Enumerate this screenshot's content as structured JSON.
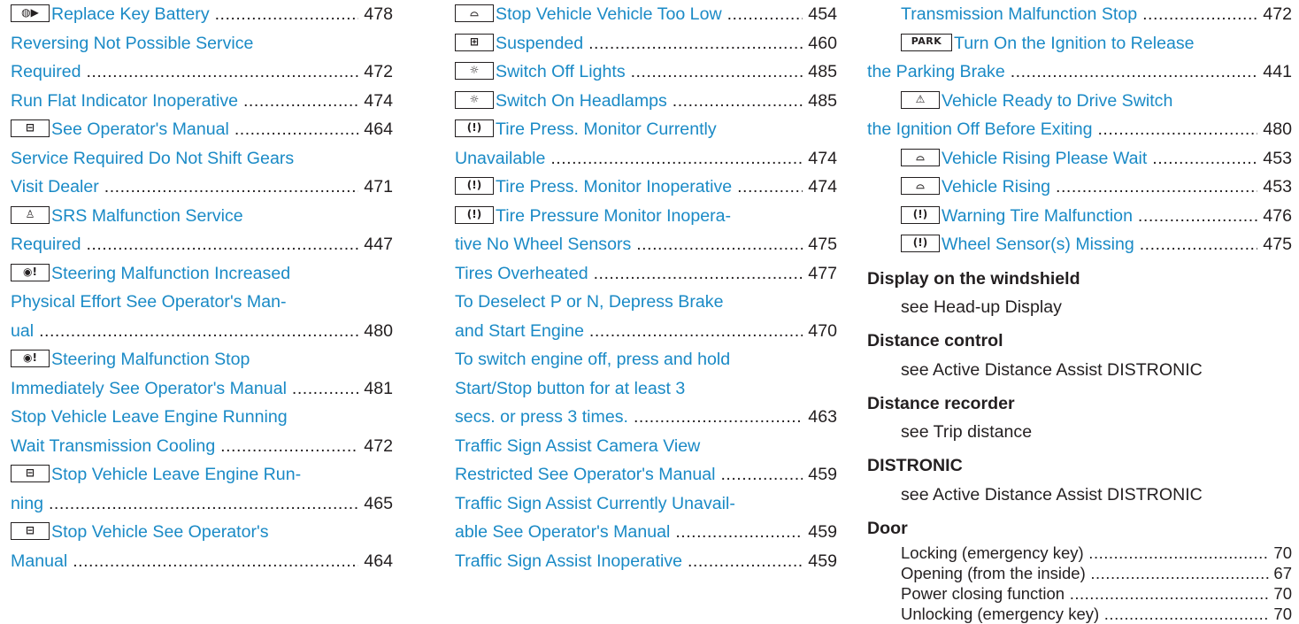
{
  "col1": [
    {
      "icon": "key-battery-icon",
      "glyph": "◍▶",
      "text": "Replace Key Battery",
      "page": "478"
    },
    {
      "text": "Reversing Not Possible Service"
    },
    {
      "text": "Required",
      "page": "472"
    },
    {
      "text": "Run Flat Indicator Inoperative",
      "page": "474"
    },
    {
      "icon": "battery-icon",
      "glyph": "⊟",
      "text": "See Operator's Manual",
      "page": "464"
    },
    {
      "text": "Service Required Do Not Shift Gears"
    },
    {
      "text": "Visit Dealer",
      "page": "471"
    },
    {
      "icon": "airbag-icon",
      "glyph": "♙",
      "text": "SRS Malfunction Service"
    },
    {
      "text": "Required",
      "page": "447"
    },
    {
      "icon": "steering-warning-icon",
      "glyph": "◉!",
      "text": "Steering Malfunction Increased"
    },
    {
      "text": "Physical Effort See Operator's Man-"
    },
    {
      "text": "ual",
      "page": "480"
    },
    {
      "icon": "steering-warning-icon",
      "glyph": "◉!",
      "text": "Steering Malfunction Stop"
    },
    {
      "text": "Immediately See Operator's Manual",
      "page": "481"
    },
    {
      "text": "Stop Vehicle Leave Engine Running"
    },
    {
      "text": "Wait Transmission Cooling",
      "page": "472"
    },
    {
      "icon": "battery-icon",
      "glyph": "⊟",
      "text": "Stop Vehicle Leave Engine Run-"
    },
    {
      "text": "ning",
      "page": "465"
    },
    {
      "icon": "battery-icon",
      "glyph": "⊟",
      "text": "Stop Vehicle See Operator's"
    },
    {
      "text": "Manual",
      "page": "464"
    }
  ],
  "col2": [
    {
      "icon": "vehicle-level-icon",
      "glyph": "⌓",
      "text": "Stop Vehicle Vehicle Too Low",
      "page": "454"
    },
    {
      "icon": "suspension-icon",
      "glyph": "⊞",
      "text": "Suspended",
      "page": "460"
    },
    {
      "icon": "light-icon",
      "glyph": "☼",
      "text": "Switch Off Lights",
      "page": "485"
    },
    {
      "icon": "light-icon",
      "glyph": "☼",
      "text": "Switch On Headlamps",
      "page": "485"
    },
    {
      "icon": "tire-pressure-icon",
      "glyph": "(!)",
      "text": "Tire Press. Monitor Currently"
    },
    {
      "text": "Unavailable",
      "page": "474"
    },
    {
      "icon": "tire-pressure-icon",
      "glyph": "(!)",
      "text": "Tire Press. Monitor Inoperative",
      "page": "474"
    },
    {
      "icon": "tire-pressure-icon",
      "glyph": "(!)",
      "text": "Tire Pressure Monitor Inopera-"
    },
    {
      "text": "tive No Wheel Sensors",
      "page": "475"
    },
    {
      "text": "Tires Overheated",
      "page": "477"
    },
    {
      "text": "To Deselect P or N, Depress Brake"
    },
    {
      "text": "and Start Engine",
      "page": "470"
    },
    {
      "text": "To switch engine off, press and hold"
    },
    {
      "text": "Start/Stop button for at least 3"
    },
    {
      "text": "secs. or press 3 times.",
      "page": "463"
    },
    {
      "text": "Traffic Sign Assist Camera View"
    },
    {
      "text": "Restricted See Operator's Manual",
      "page": "459"
    },
    {
      "text": "Traffic Sign Assist Currently Unavail-"
    },
    {
      "text": "able See Operator's Manual",
      "page": "459"
    },
    {
      "text": "Traffic Sign Assist Inoperative",
      "page": "459"
    }
  ],
  "col3_top": [
    {
      "text": "Transmission Malfunction Stop",
      "page": "472",
      "indent": true
    },
    {
      "icon": "park-icon",
      "glyph": "PARK",
      "text": "Turn On the Ignition to Release",
      "indent": true
    },
    {
      "text": "the Parking Brake",
      "page": "441"
    },
    {
      "icon": "warning-triangle-icon",
      "glyph": "⚠",
      "text": "Vehicle Ready to Drive Switch",
      "indent": true
    },
    {
      "text": "the Ignition Off Before Exiting",
      "page": "480"
    },
    {
      "icon": "vehicle-level-icon",
      "glyph": "⌓",
      "text": "Vehicle Rising Please Wait",
      "page": "453",
      "indent": true
    },
    {
      "icon": "vehicle-level-icon",
      "glyph": "⌓",
      "text": "Vehicle Rising",
      "page": "453",
      "indent": true
    },
    {
      "icon": "tire-pressure-icon",
      "glyph": "(!)",
      "text": "Warning Tire Malfunction",
      "page": "476",
      "indent": true
    },
    {
      "icon": "tire-pressure-icon",
      "glyph": "(!)",
      "text": "Wheel Sensor(s) Missing",
      "page": "475",
      "indent": true
    }
  ],
  "col3_entries": [
    {
      "head": "Display on the windshield",
      "see": "see Head-up Display"
    },
    {
      "head": "Distance control",
      "see": "see Active Distance Assist DISTRONIC"
    },
    {
      "head": "Distance recorder",
      "see": "see Trip distance"
    },
    {
      "head": "DISTRONIC",
      "see": "see Active Distance Assist DISTRONIC"
    }
  ],
  "door": {
    "head": "Door",
    "items": [
      {
        "text": "Locking (emergency key)",
        "page": "70"
      },
      {
        "text": "Opening (from the inside)",
        "page": "67"
      },
      {
        "text": "Power closing function",
        "page": "70"
      },
      {
        "text": "Unlocking (emergency key)",
        "page": "70"
      }
    ]
  }
}
